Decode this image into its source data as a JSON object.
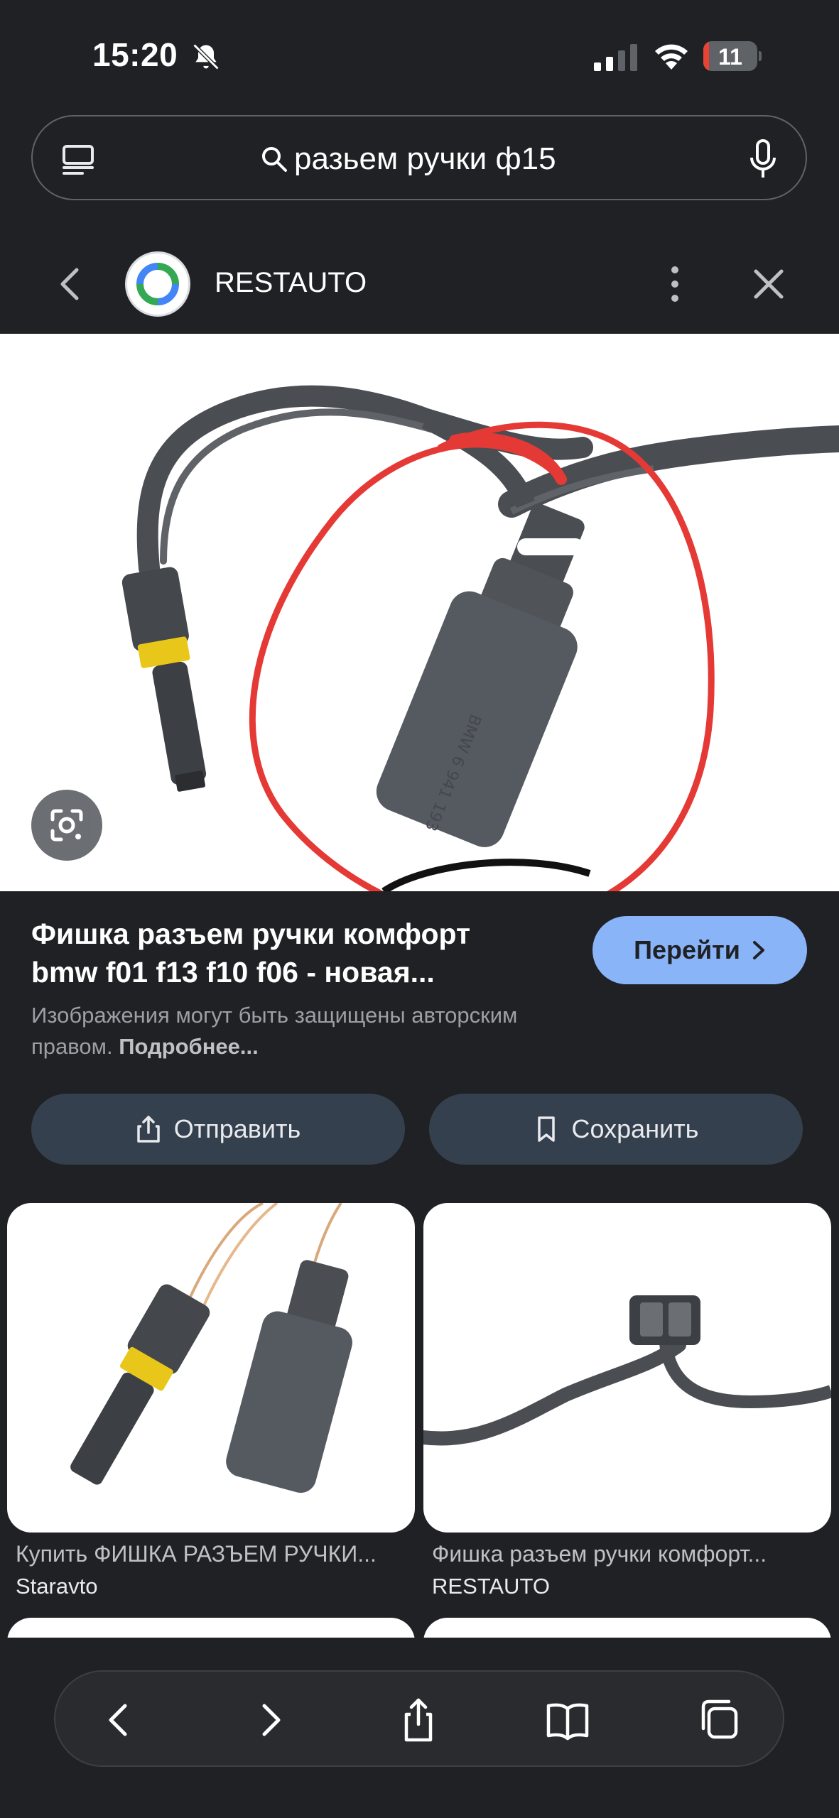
{
  "status_bar": {
    "time": "15:20",
    "battery_level": "11",
    "battery_fraction": 0.11,
    "battery_color": "#ea4335",
    "icons": [
      "bell-off-icon",
      "signal-icon",
      "wifi-icon",
      "battery-icon"
    ]
  },
  "search": {
    "query": "разьем ручки ф15",
    "icons": [
      "tab-list-icon",
      "search-icon",
      "mic-icon"
    ]
  },
  "source": {
    "name": "RESTAUTO",
    "icons": [
      "back-chevron-icon",
      "more-vertical-icon",
      "close-icon"
    ]
  },
  "result": {
    "title": "Фишка разъем ручки комфорт bmw f01 f13 f10 f06 - новая...",
    "go_label": "Перейти",
    "copyright_text": "Изображения могут быть защищены авторским правом.",
    "copyright_more": "Подробнее..."
  },
  "actions": {
    "share_label": "Отправить",
    "save_label": "Сохранить"
  },
  "related": [
    {
      "title": "Купить ФИШКА РАЗЪЕМ РУЧКИ...",
      "source": "Staravto"
    },
    {
      "title": "Фишка разъем ручки комфорт...",
      "source": "RESTAUTO"
    }
  ],
  "colors": {
    "background": "#202124",
    "accent_button": "#8ab4f8",
    "action_button": "#35404f",
    "annotation_circle": "#e53935"
  },
  "toolbar": {
    "icons": [
      "back-icon",
      "forward-icon",
      "share-icon",
      "bookmarks-icon",
      "tabs-icon"
    ]
  }
}
